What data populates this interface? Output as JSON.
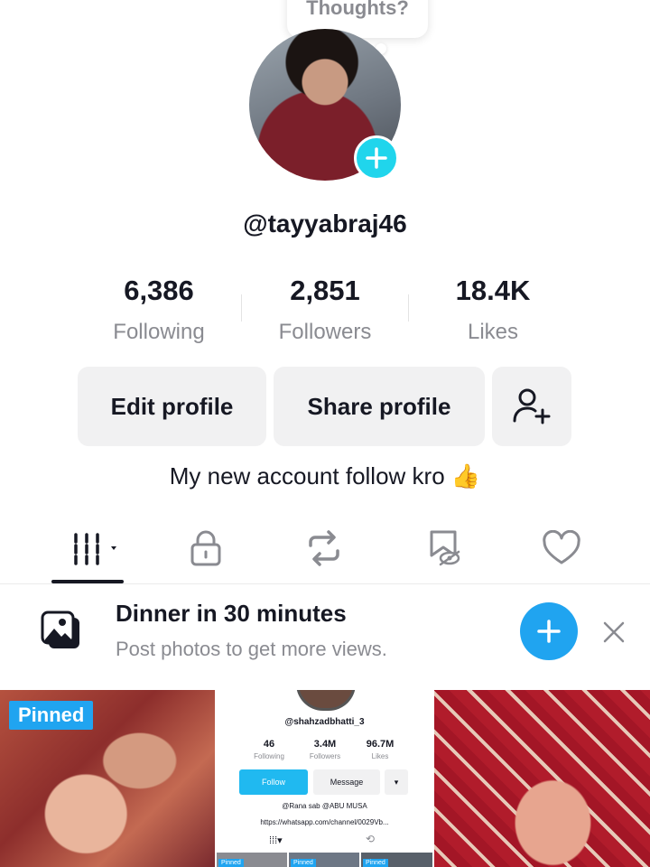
{
  "bubble": {
    "text": "Thoughts?"
  },
  "profile": {
    "username": "@tayyabraj46",
    "bio": "My new account follow kro 👍"
  },
  "stats": [
    {
      "value": "6,386",
      "label": "Following"
    },
    {
      "value": "2,851",
      "label": "Followers"
    },
    {
      "value": "18.4K",
      "label": "Likes"
    }
  ],
  "actions": {
    "edit": "Edit profile",
    "share": "Share profile"
  },
  "tabs": [
    "grid-icon",
    "lock-icon",
    "repost-icon",
    "hidden-likes-icon",
    "heart-icon"
  ],
  "banner": {
    "title": "Dinner in 30 minutes",
    "subtitle": "Post photos to get more views."
  },
  "thumbs": {
    "pinned_label": "Pinned",
    "mini": {
      "username": "@shahzadbhatti_3",
      "following_num": "46",
      "following_lbl": "Following",
      "followers_num": "3.4M",
      "followers_lbl": "Followers",
      "likes_num": "96.7M",
      "likes_lbl": "Likes",
      "follow_btn": "Follow",
      "message_btn": "Message",
      "bio": "@Rana sab @ABU MUSA",
      "link": "https://whatsapp.com/channel/0029Vb...",
      "pinned": "Pinned"
    }
  },
  "colors": {
    "accent": "#20d5ec",
    "blue": "#20a4f0",
    "text": "#161823",
    "muted": "#8a8b91"
  }
}
